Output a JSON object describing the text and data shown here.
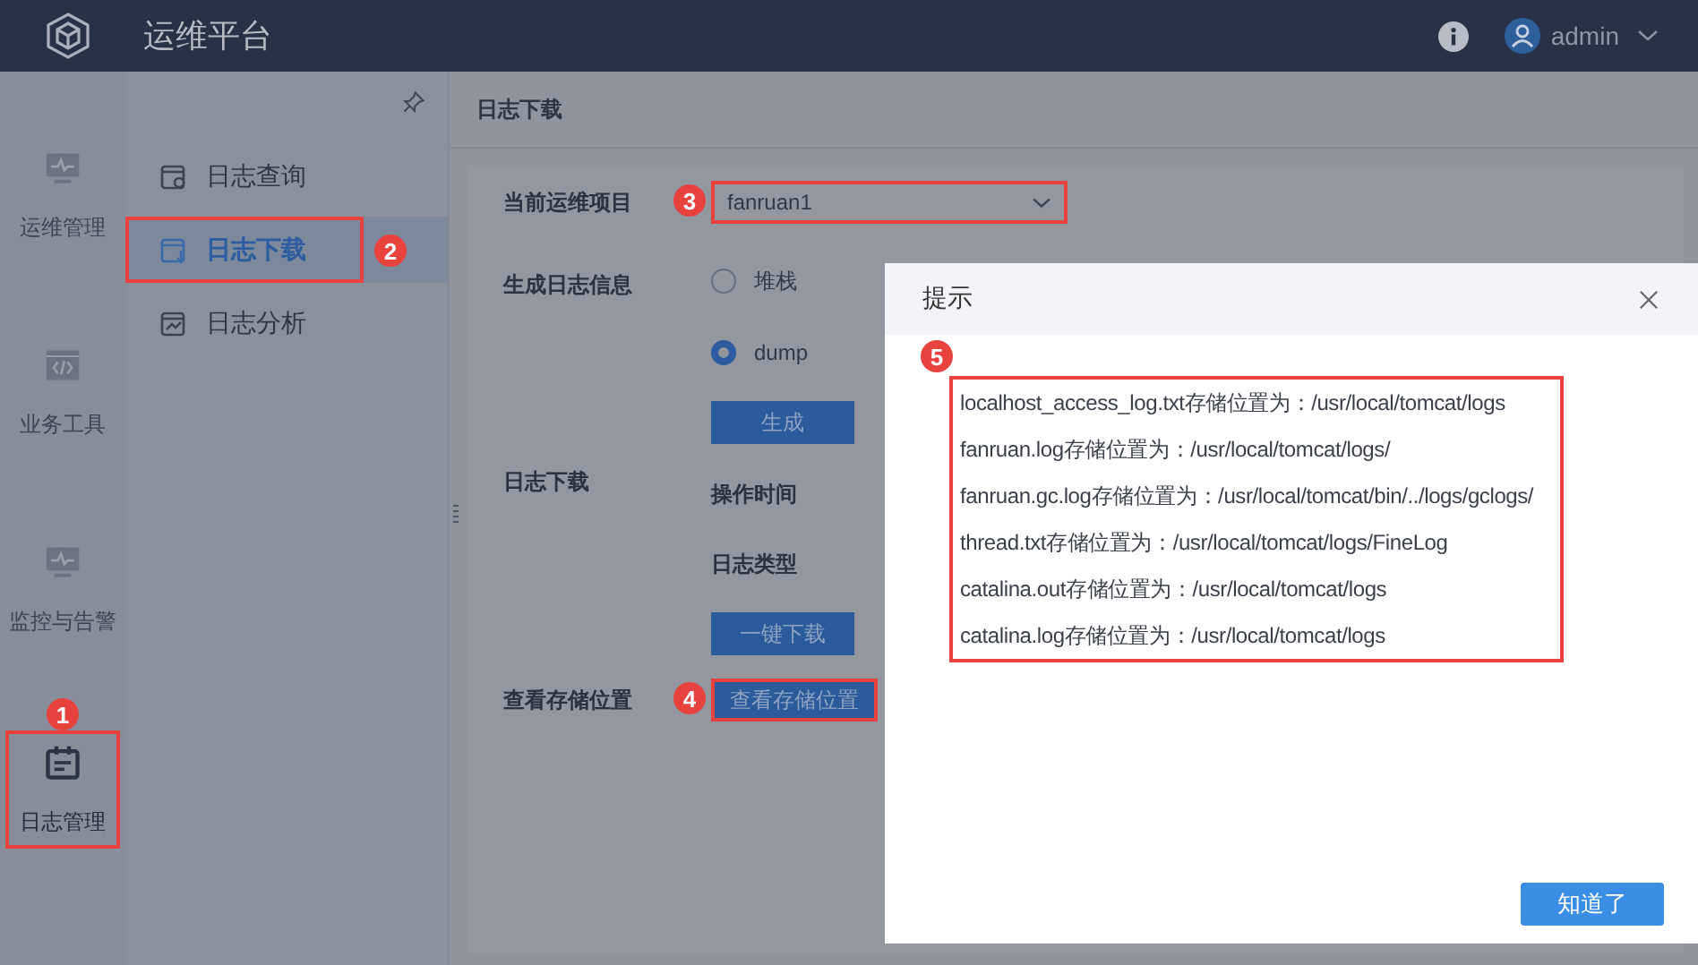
{
  "app": {
    "title": "运维平台",
    "user": "admin"
  },
  "rail": [
    {
      "label": "运维管理",
      "kind": "monitor",
      "selected": false
    },
    {
      "label": "业务工具",
      "kind": "code",
      "selected": false
    },
    {
      "label": "监控与告警",
      "kind": "monitor",
      "selected": false
    },
    {
      "label": "日志管理",
      "kind": "calendar",
      "selected": true,
      "marker": "1"
    }
  ],
  "submenu": [
    {
      "label": "日志查询",
      "kind": "search",
      "selected": false
    },
    {
      "label": "日志下载",
      "kind": "download",
      "selected": true,
      "marker": "2"
    },
    {
      "label": "日志分析",
      "kind": "chart",
      "selected": false
    }
  ],
  "page": {
    "title": "日志下载",
    "project": {
      "label": "当前运维项目",
      "value": "fanruan1",
      "marker": "3"
    },
    "generate": {
      "label": "生成日志信息",
      "options": [
        {
          "label": "堆栈",
          "selected": false
        },
        {
          "label": "dump",
          "selected": true
        }
      ],
      "button": "生成"
    },
    "download": {
      "label": "日志下载",
      "fields": [
        "操作时间",
        "日志类型"
      ],
      "button": "一键下载"
    },
    "storage": {
      "label": "查看存储位置",
      "button": "查看存储位置",
      "marker": "4"
    }
  },
  "dialog": {
    "title": "提示",
    "marker": "5",
    "lines": [
      "localhost_access_log.txt存储位置为：/usr/local/tomcat/logs",
      "fanruan.log存储位置为：/usr/local/tomcat/logs/",
      "fanruan.gc.log存储位置为：/usr/local/tomcat/bin/../logs/gclogs/",
      "thread.txt存储位置为：/usr/local/tomcat/logs/FineLog",
      "catalina.out存储位置为：/usr/local/tomcat/logs",
      "catalina.log存储位置为：/usr/local/tomcat/logs"
    ],
    "ok": "知道了"
  }
}
